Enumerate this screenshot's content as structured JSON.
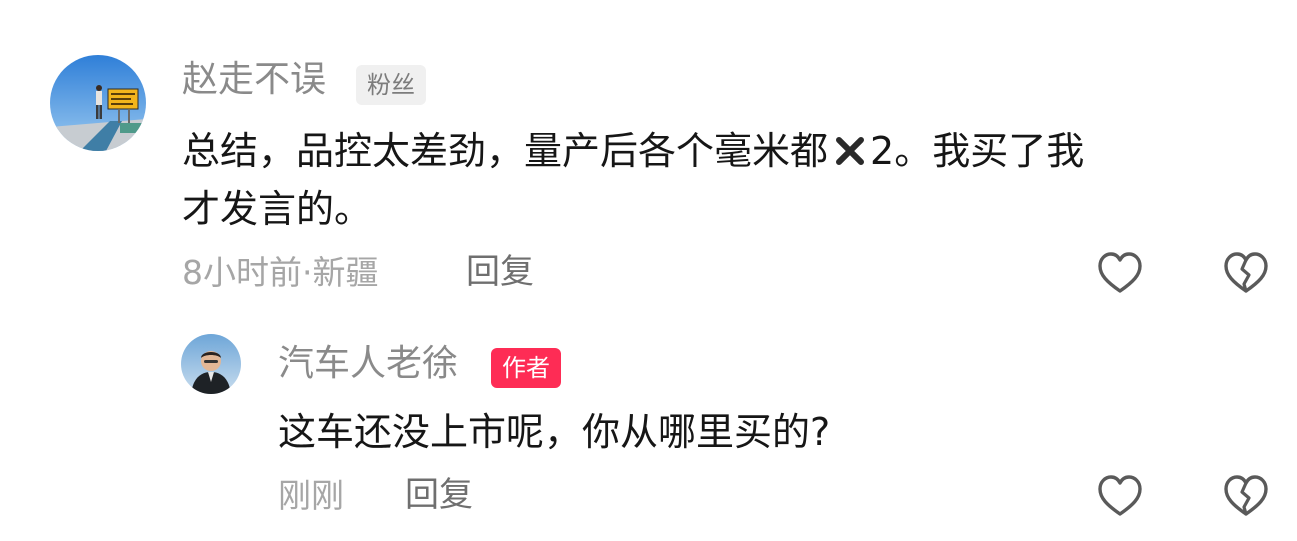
{
  "comment": {
    "username": "赵走不误",
    "badge": "粉丝",
    "text_before_icon": "总结，品控太差劲，量产后各个毫米都",
    "icon": "cross-mark-icon",
    "text_after_icon": "2。我买了我",
    "text_line2": "才发言的。",
    "meta": "8小时前·新疆",
    "reply_label": "回复"
  },
  "reply": {
    "username": "汽车人老徐",
    "badge": "作者",
    "text": "这车还没上市呢，你从哪里买的?",
    "meta": "刚刚",
    "reply_label": "回复"
  },
  "icons": {
    "like": "heart-outline-icon",
    "dislike": "broken-heart-icon"
  },
  "colors": {
    "author_badge": "#fe2c55",
    "fan_badge_bg": "#f0f0f0",
    "username": "#8a8a8a",
    "body_text": "#161616",
    "meta_text": "#a6a6a6"
  }
}
